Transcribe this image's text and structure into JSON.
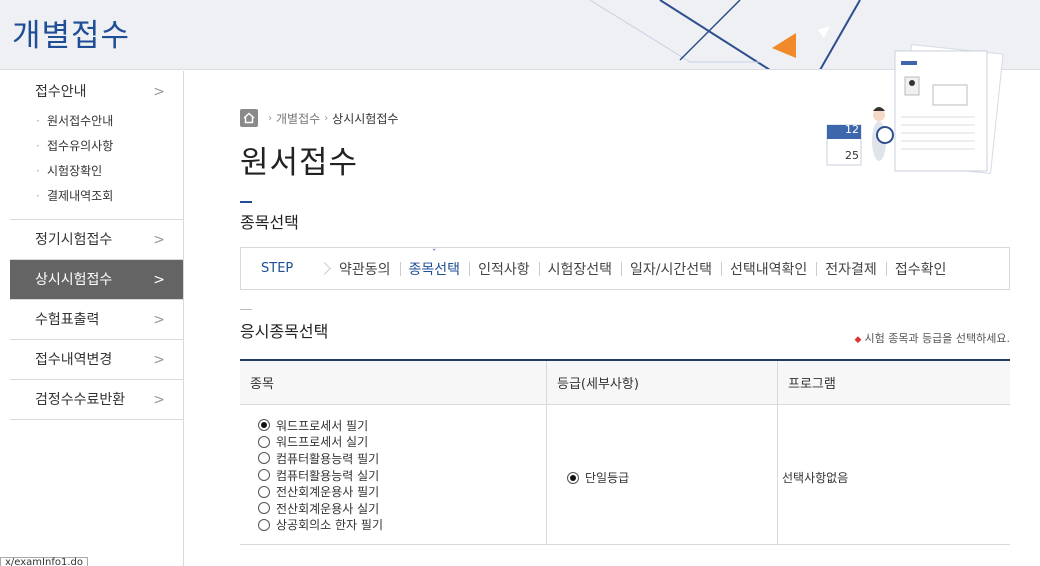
{
  "header": {
    "title": "개별접수"
  },
  "sidebar": {
    "first_section": {
      "label": "접수안내",
      "items": [
        "원서접수안내",
        "접수유의사항",
        "시험장확인",
        "결제내역조회"
      ]
    },
    "items": [
      {
        "label": "정기시험접수",
        "active": false
      },
      {
        "label": "상시시험접수",
        "active": true
      },
      {
        "label": "수험표출력",
        "active": false
      },
      {
        "label": "접수내역변경",
        "active": false
      },
      {
        "label": "검정수수료반환",
        "active": false
      }
    ],
    "arrow": ">"
  },
  "breadcrumb": {
    "items": [
      "개별접수",
      "상시시험접수"
    ]
  },
  "page_title": "원서접수",
  "section_title": "종목선택",
  "illustration": {
    "calendar_top": "12",
    "calendar_bottom": "25"
  },
  "steps": {
    "label": "STEP",
    "items": [
      "약관동의",
      "종목선택",
      "인적사항",
      "시험장선택",
      "일자/시간선택",
      "선택내역확인",
      "전자결제",
      "접수확인"
    ],
    "current_index": 1
  },
  "subsection": {
    "title": "응시종목선택",
    "note": "시험 종목과 등급을 선택하세요."
  },
  "table": {
    "headers": [
      "종목",
      "등급(세부사항)",
      "프로그램"
    ],
    "subjects": [
      {
        "label": "워드프로세서 필기",
        "checked": true
      },
      {
        "label": "워드프로세서 실기",
        "checked": false
      },
      {
        "label": "컴퓨터활용능력 필기",
        "checked": false
      },
      {
        "label": "컴퓨터활용능력 실기",
        "checked": false
      },
      {
        "label": "전산회계운용사 필기",
        "checked": false
      },
      {
        "label": "전산회계운용사 실기",
        "checked": false
      },
      {
        "label": "상공회의소 한자 필기",
        "checked": false
      }
    ],
    "grade": {
      "label": "단일등급",
      "checked": true
    },
    "program": "선택사항없음"
  },
  "statusbar": {
    "text": "x/examInfo1.do"
  },
  "colors": {
    "accent": "#1f4e96",
    "active_menu": "#646464"
  }
}
